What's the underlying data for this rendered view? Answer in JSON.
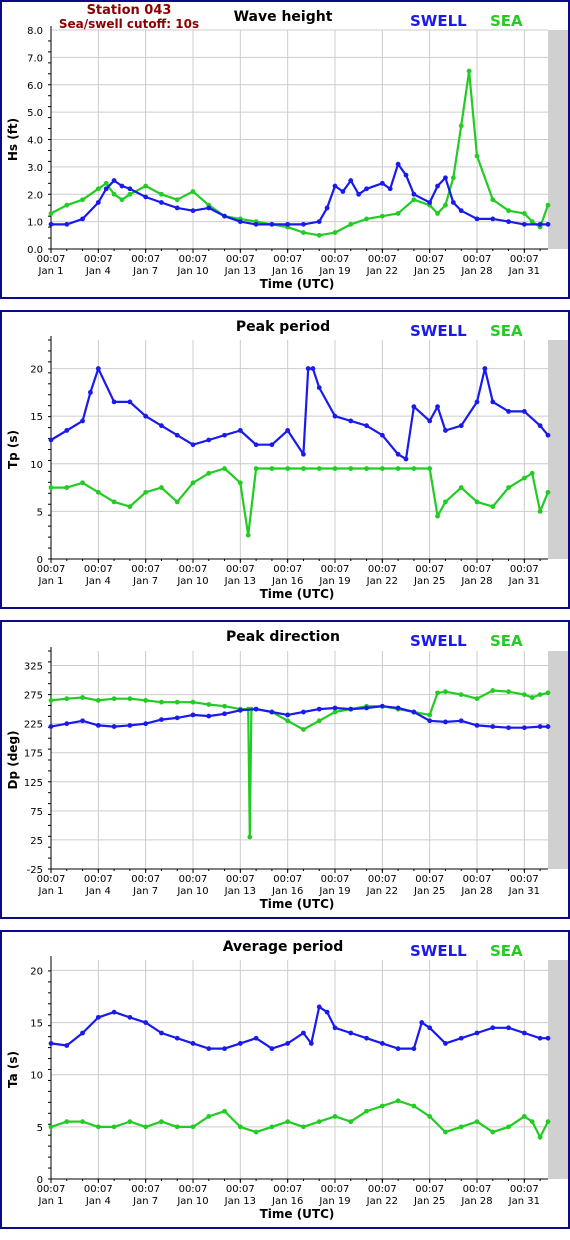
{
  "header": {
    "station": "Station 043",
    "cutoff": "Sea/swell cutoff: 10s"
  },
  "colors": {
    "swell": "#1a1aee",
    "sea": "#22cc22",
    "border": "#0a0a8a",
    "station": "#8b0000"
  },
  "chart_data": [
    {
      "type": "line",
      "title": "Wave height",
      "ylabel": "Hs (ft)",
      "xlabel": "Time (UTC)",
      "ylim": [
        0,
        8
      ],
      "yticks": [
        "0.0",
        "1.0",
        "2.0",
        "3.0",
        "4.0",
        "5.0",
        "6.0",
        "7.0",
        "8.0"
      ],
      "ytick_values": [
        0,
        1,
        2,
        3,
        4,
        5,
        6,
        7,
        8
      ],
      "xlim": [
        0,
        31.5
      ],
      "xticks_top": [
        "00:07",
        "00:07",
        "00:07",
        "00:07",
        "00:07",
        "00:07",
        "00:07",
        "00:07",
        "00:07",
        "00:07",
        "00:07"
      ],
      "xticks_bottom": [
        "Jan 1",
        "Jan 4",
        "Jan 7",
        "Jan 10",
        "Jan 13",
        "Jan 16",
        "Jan 19",
        "Jan 22",
        "Jan 25",
        "Jan 28",
        "Jan 31"
      ],
      "xtick_days": [
        0,
        3,
        6,
        9,
        12,
        15,
        18,
        21,
        24,
        27,
        30
      ],
      "grid": true,
      "legend": [
        "SWELL",
        "SEA"
      ],
      "series": [
        {
          "name": "SWELL",
          "x": [
            0,
            1,
            2,
            3,
            3.5,
            4,
            4.5,
            5,
            6,
            7,
            8,
            9,
            10,
            11,
            12,
            13,
            14,
            15,
            16,
            17,
            17.5,
            18,
            18.5,
            19,
            19.5,
            20,
            21,
            21.5,
            22,
            22.5,
            23,
            24,
            24.5,
            25,
            25.5,
            26,
            27,
            28,
            29,
            30,
            31,
            31.5
          ],
          "values": [
            0.9,
            0.9,
            1.1,
            1.7,
            2.2,
            2.5,
            2.3,
            2.2,
            1.9,
            1.7,
            1.5,
            1.4,
            1.5,
            1.2,
            1.0,
            0.9,
            0.9,
            0.9,
            0.9,
            1.0,
            1.5,
            2.3,
            2.1,
            2.5,
            2.0,
            2.2,
            2.4,
            2.2,
            3.1,
            2.7,
            2.0,
            1.7,
            2.3,
            2.6,
            1.7,
            1.4,
            1.1,
            1.1,
            1.0,
            0.9,
            0.9,
            0.9
          ]
        },
        {
          "name": "SEA",
          "x": [
            0,
            1,
            2,
            3,
            3.5,
            4,
            4.5,
            5,
            6,
            7,
            8,
            9,
            10,
            11,
            12,
            13,
            14,
            15,
            16,
            17,
            18,
            19,
            20,
            21,
            22,
            23,
            24,
            24.5,
            25,
            25.5,
            26,
            26.5,
            27,
            28,
            29,
            30,
            30.5,
            31,
            31.5
          ],
          "values": [
            1.3,
            1.6,
            1.8,
            2.2,
            2.4,
            2.0,
            1.8,
            2.0,
            2.3,
            2.0,
            1.8,
            2.1,
            1.6,
            1.2,
            1.1,
            1.0,
            0.9,
            0.8,
            0.6,
            0.5,
            0.6,
            0.9,
            1.1,
            1.2,
            1.3,
            1.8,
            1.6,
            1.3,
            1.6,
            2.6,
            4.5,
            6.5,
            3.4,
            1.8,
            1.4,
            1.3,
            1.0,
            0.8,
            1.6
          ]
        }
      ]
    },
    {
      "type": "line",
      "title": "Peak period",
      "ylabel": "Tp (s)",
      "xlabel": "Time (UTC)",
      "ylim": [
        0,
        23
      ],
      "yticks": [
        "0",
        "5",
        "10",
        "15",
        "20"
      ],
      "ytick_values": [
        0,
        5,
        10,
        15,
        20
      ],
      "xlim": [
        0,
        31.5
      ],
      "xticks_top": [
        "00:07",
        "00:07",
        "00:07",
        "00:07",
        "00:07",
        "00:07",
        "00:07",
        "00:07",
        "00:07",
        "00:07",
        "00:07"
      ],
      "xticks_bottom": [
        "Jan 1",
        "Jan 4",
        "Jan 7",
        "Jan 10",
        "Jan 13",
        "Jan 16",
        "Jan 19",
        "Jan 22",
        "Jan 25",
        "Jan 28",
        "Jan 31"
      ],
      "xtick_days": [
        0,
        3,
        6,
        9,
        12,
        15,
        18,
        21,
        24,
        27,
        30
      ],
      "grid": true,
      "legend": [
        "SWELL",
        "SEA"
      ],
      "series": [
        {
          "name": "SWELL",
          "x": [
            0,
            1,
            2,
            2.5,
            3,
            4,
            5,
            6,
            7,
            8,
            9,
            10,
            11,
            12,
            13,
            14,
            15,
            16,
            16.3,
            16.6,
            17,
            18,
            19,
            20,
            21,
            22,
            22.5,
            23,
            24,
            24.5,
            25,
            26,
            27,
            27.5,
            28,
            29,
            30,
            31,
            31.5
          ],
          "values": [
            12.5,
            13.5,
            14.5,
            17.5,
            20,
            16.5,
            16.5,
            15,
            14,
            13,
            12,
            12.5,
            13,
            13.5,
            12,
            12,
            13.5,
            11,
            20,
            20,
            18,
            15,
            14.5,
            14,
            13,
            11,
            10.5,
            16,
            14.5,
            16,
            13.5,
            14,
            16.5,
            20,
            16.5,
            15.5,
            15.5,
            14,
            13
          ]
        },
        {
          "name": "SEA",
          "x": [
            0,
            1,
            2,
            3,
            4,
            5,
            6,
            7,
            8,
            9,
            10,
            11,
            12,
            12.5,
            13,
            14,
            15,
            16,
            17,
            18,
            19,
            20,
            21,
            22,
            23,
            24,
            24.5,
            25,
            26,
            27,
            28,
            29,
            30,
            30.5,
            31,
            31.5
          ],
          "values": [
            7.5,
            7.5,
            8,
            7,
            6,
            5.5,
            7,
            7.5,
            6,
            8,
            9,
            9.5,
            8,
            2.5,
            9.5,
            9.5,
            9.5,
            9.5,
            9.5,
            9.5,
            9.5,
            9.5,
            9.5,
            9.5,
            9.5,
            9.5,
            4.5,
            6,
            7.5,
            6,
            5.5,
            7.5,
            8.5,
            9,
            5,
            7
          ]
        }
      ]
    },
    {
      "type": "line",
      "title": "Peak direction",
      "ylabel": "Dp (deg)",
      "xlabel": "Time (UTC)",
      "ylim": [
        -25,
        350
      ],
      "yticks": [
        "-25",
        "25",
        "75",
        "125",
        "175",
        "225",
        "275",
        "325"
      ],
      "ytick_values": [
        -25,
        25,
        75,
        125,
        175,
        225,
        275,
        325
      ],
      "xlim": [
        0,
        31.5
      ],
      "xticks_top": [
        "00:07",
        "00:07",
        "00:07",
        "00:07",
        "00:07",
        "00:07",
        "00:07",
        "00:07",
        "00:07",
        "00:07",
        "00:07"
      ],
      "xticks_bottom": [
        "Jan 1",
        "Jan 4",
        "Jan 7",
        "Jan 10",
        "Jan 13",
        "Jan 16",
        "Jan 19",
        "Jan 22",
        "Jan 25",
        "Jan 28",
        "Jan 31"
      ],
      "xtick_days": [
        0,
        3,
        6,
        9,
        12,
        15,
        18,
        21,
        24,
        27,
        30
      ],
      "grid": true,
      "legend": [
        "SWELL",
        "SEA"
      ],
      "series": [
        {
          "name": "SWELL",
          "x": [
            0,
            1,
            2,
            3,
            4,
            5,
            6,
            7,
            8,
            9,
            10,
            11,
            12,
            13,
            14,
            15,
            16,
            17,
            18,
            19,
            20,
            21,
            22,
            23,
            24,
            25,
            26,
            27,
            28,
            29,
            30,
            31,
            31.5
          ],
          "values": [
            220,
            225,
            230,
            222,
            220,
            222,
            225,
            232,
            235,
            240,
            238,
            242,
            248,
            250,
            245,
            240,
            245,
            250,
            252,
            250,
            252,
            255,
            252,
            245,
            230,
            228,
            230,
            222,
            220,
            218,
            218,
            220,
            220
          ]
        },
        {
          "name": "SEA",
          "x": [
            0,
            1,
            2,
            3,
            4,
            5,
            6,
            7,
            8,
            9,
            10,
            11,
            12,
            12.5,
            12.6,
            12.7,
            13,
            14,
            15,
            16,
            17,
            18,
            19,
            20,
            21,
            22,
            23,
            24,
            24.5,
            25,
            26,
            27,
            28,
            29,
            30,
            30.5,
            31,
            31.5
          ],
          "values": [
            265,
            268,
            270,
            265,
            268,
            268,
            265,
            262,
            262,
            262,
            258,
            255,
            250,
            250,
            30,
            250,
            250,
            245,
            230,
            215,
            230,
            245,
            250,
            255,
            255,
            250,
            245,
            240,
            278,
            280,
            275,
            268,
            282,
            280,
            275,
            270,
            275,
            278
          ]
        }
      ]
    },
    {
      "type": "line",
      "title": "Average period",
      "ylabel": "Ta (s)",
      "xlabel": "Time (UTC)",
      "ylim": [
        0,
        21
      ],
      "yticks": [
        "0",
        "5",
        "10",
        "15",
        "20"
      ],
      "ytick_values": [
        0,
        5,
        10,
        15,
        20
      ],
      "xlim": [
        0,
        31.5
      ],
      "xticks_top": [
        "00:07",
        "00:07",
        "00:07",
        "00:07",
        "00:07",
        "00:07",
        "00:07",
        "00:07",
        "00:07",
        "00:07",
        "00:07"
      ],
      "xticks_bottom": [
        "Jan 1",
        "Jan 4",
        "Jan 7",
        "Jan 10",
        "Jan 13",
        "Jan 16",
        "Jan 19",
        "Jan 22",
        "Jan 25",
        "Jan 28",
        "Jan 31"
      ],
      "xtick_days": [
        0,
        3,
        6,
        9,
        12,
        15,
        18,
        21,
        24,
        27,
        30
      ],
      "grid": true,
      "legend": [
        "SWELL",
        "SEA"
      ],
      "series": [
        {
          "name": "SWELL",
          "x": [
            0,
            1,
            2,
            3,
            4,
            5,
            6,
            7,
            8,
            9,
            10,
            11,
            12,
            13,
            14,
            15,
            16,
            16.5,
            17,
            17.5,
            18,
            19,
            20,
            21,
            22,
            23,
            23.5,
            24,
            25,
            26,
            27,
            28,
            29,
            30,
            31,
            31.5
          ],
          "values": [
            13,
            12.8,
            14,
            15.5,
            16,
            15.5,
            15,
            14,
            13.5,
            13,
            12.5,
            12.5,
            13,
            13.5,
            12.5,
            13,
            14,
            13,
            16.5,
            16,
            14.5,
            14,
            13.5,
            13,
            12.5,
            12.5,
            15,
            14.5,
            13,
            13.5,
            14,
            14.5,
            14.5,
            14,
            13.5,
            13.5
          ]
        },
        {
          "name": "SEA",
          "x": [
            0,
            1,
            2,
            3,
            4,
            5,
            6,
            7,
            8,
            9,
            10,
            11,
            12,
            13,
            14,
            15,
            16,
            17,
            18,
            19,
            20,
            21,
            22,
            23,
            24,
            25,
            26,
            27,
            28,
            29,
            30,
            30.5,
            31,
            31.5
          ],
          "values": [
            5,
            5.5,
            5.5,
            5,
            5,
            5.5,
            5,
            5.5,
            5,
            5,
            6,
            6.5,
            5,
            4.5,
            5,
            5.5,
            5,
            5.5,
            6,
            5.5,
            6.5,
            7,
            7.5,
            7,
            6,
            4.5,
            5,
            5.5,
            4.5,
            5,
            6,
            5.5,
            4,
            5.5
          ]
        }
      ]
    }
  ]
}
